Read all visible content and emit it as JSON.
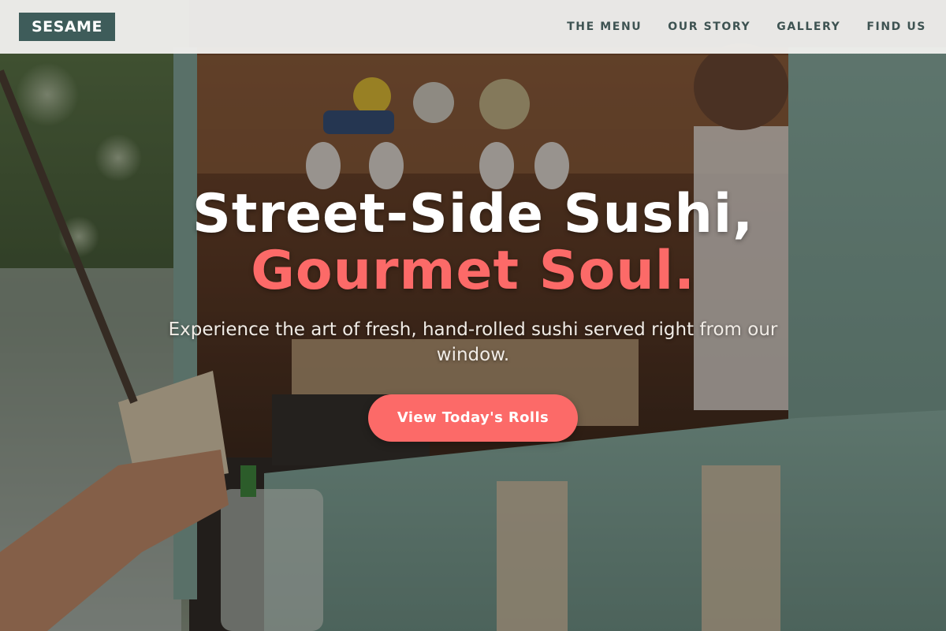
{
  "brand": {
    "logo_text": "SESAME"
  },
  "nav": {
    "items": [
      {
        "label": "THE MENU"
      },
      {
        "label": "OUR STORY"
      },
      {
        "label": "GALLERY"
      },
      {
        "label": "FIND US"
      }
    ]
  },
  "hero": {
    "headline_line1": "Street-Side Sushi,",
    "headline_line2": "Gourmet Soul.",
    "subtitle": "Experience the art of fresh, hand-rolled sushi served right from our window.",
    "cta_label": "View Today's Rolls",
    "background_image": "food-truck-serving-window-photo"
  },
  "colors": {
    "header_bg": "#f0efed",
    "logo_bg": "#3e5c5a",
    "nav_text": "#3e5352",
    "accent": "#fc6a68",
    "headline_text": "#ffffff"
  }
}
